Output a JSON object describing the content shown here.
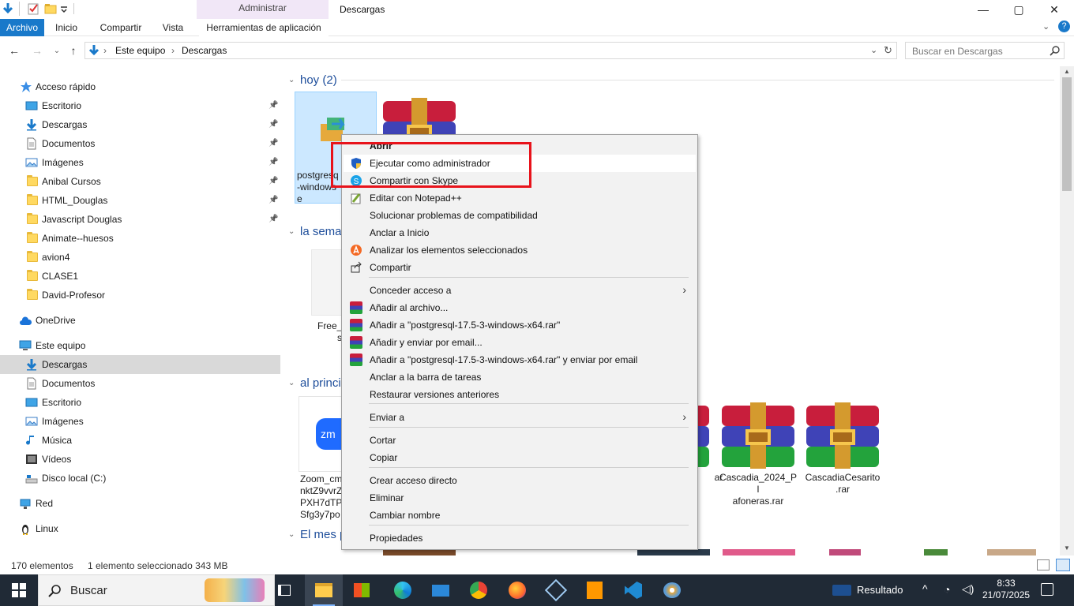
{
  "window": {
    "title": "Descargas",
    "context_tab_group": "Administrar",
    "controls": {
      "minimize": "—",
      "maximize": "▢",
      "close": "✕"
    }
  },
  "ribbon": {
    "tabs": [
      {
        "label": "Archivo"
      },
      {
        "label": "Inicio"
      },
      {
        "label": "Compartir"
      },
      {
        "label": "Vista"
      },
      {
        "label": "Herramientas de aplicación"
      }
    ]
  },
  "address": {
    "crumbs": [
      "Este equipo",
      "Descargas"
    ],
    "search_placeholder": "Buscar en Descargas"
  },
  "navpane": {
    "quick_access": "Acceso rápido",
    "items": [
      {
        "label": "Escritorio",
        "icon": "desktop-icon",
        "pinned": true
      },
      {
        "label": "Descargas",
        "icon": "download-icon",
        "pinned": true
      },
      {
        "label": "Documentos",
        "icon": "document-icon",
        "pinned": true
      },
      {
        "label": "Imágenes",
        "icon": "pictures-icon",
        "pinned": true
      },
      {
        "label": "Anibal Cursos",
        "icon": "folder-icon",
        "pinned": true
      },
      {
        "label": "HTML_Douglas",
        "icon": "folder-icon",
        "pinned": true
      },
      {
        "label": "Javascript Douglas",
        "icon": "folder-icon",
        "pinned": true
      },
      {
        "label": "Animate--huesos",
        "icon": "folder-icon",
        "pinned": false
      },
      {
        "label": "avion4",
        "icon": "folder-icon",
        "pinned": false
      },
      {
        "label": "CLASE1",
        "icon": "folder-icon",
        "pinned": false
      },
      {
        "label": "David-Profesor",
        "icon": "folder-icon",
        "pinned": false
      }
    ],
    "onedrive": "OneDrive",
    "this_pc": "Este equipo",
    "pc_items": [
      {
        "label": "Descargas",
        "icon": "download-icon",
        "selected": true
      },
      {
        "label": "Documentos",
        "icon": "document-icon",
        "selected": false
      },
      {
        "label": "Escritorio",
        "icon": "desktop-icon",
        "selected": false
      },
      {
        "label": "Imágenes",
        "icon": "pictures-icon",
        "selected": false
      },
      {
        "label": "Música",
        "icon": "music-icon",
        "selected": false
      },
      {
        "label": "Vídeos",
        "icon": "video-icon",
        "selected": false
      },
      {
        "label": "Disco local (C:)",
        "icon": "drive-icon",
        "selected": false
      }
    ],
    "network": "Red",
    "linux": "Linux"
  },
  "content": {
    "groups": [
      {
        "label": "hoy (2)"
      },
      {
        "label": "la sema"
      },
      {
        "label": "al princi"
      },
      {
        "label": "El mes p"
      }
    ],
    "files": [
      {
        "name": "postgresq\n-windows\ne",
        "selected": true
      },
      {
        "name": "",
        "selected": false
      },
      {
        "name": "Free_Toll_\ns",
        "selected": false
      },
      {
        "name": "Zoom_cm\nnktZ9vvrZ\nPXH7dTP\nSfg3y7po",
        "selected": false
      },
      {
        "name": "ar",
        "selected": false
      },
      {
        "name": "Cascadia_2024_Pl\nafoneras.rar",
        "selected": false
      },
      {
        "name": "CascadiaCesarito\n.rar",
        "selected": false
      }
    ]
  },
  "status": {
    "count": "170 elementos",
    "selection": "1 elemento seleccionado  343 MB"
  },
  "context_menu": {
    "items": [
      {
        "label": "Abrir",
        "icon": "",
        "bold": true
      },
      {
        "label": "Ejecutar como administrador",
        "icon": "uac-shield-icon",
        "hover": true
      },
      {
        "label": "Compartir con Skype",
        "icon": "skype-icon"
      },
      {
        "label": "Editar con Notepad++",
        "icon": "notepadpp-icon"
      },
      {
        "label": "Solucionar problemas de compatibilidad",
        "icon": ""
      },
      {
        "label": "Anclar a Inicio",
        "icon": ""
      },
      {
        "label": "Analizar los elementos seleccionados",
        "icon": "avast-icon"
      },
      {
        "label": "Compartir",
        "icon": "share-icon"
      },
      {
        "label": "Conceder acceso a",
        "icon": "",
        "submenu": true
      },
      {
        "label": "Añadir al archivo...",
        "icon": "winrar-icon"
      },
      {
        "label": "Añadir a \"postgresql-17.5-3-windows-x64.rar\"",
        "icon": "winrar-icon"
      },
      {
        "label": "Añadir y enviar por email...",
        "icon": "winrar-icon"
      },
      {
        "label": "Añadir a \"postgresql-17.5-3-windows-x64.rar\" y enviar por email",
        "icon": "winrar-icon"
      },
      {
        "label": "Anclar a la barra de tareas",
        "icon": ""
      },
      {
        "label": "Restaurar versiones anteriores",
        "icon": ""
      },
      {
        "label": "Enviar a",
        "icon": "",
        "submenu": true
      },
      {
        "label": "Cortar",
        "icon": ""
      },
      {
        "label": "Copiar",
        "icon": ""
      },
      {
        "label": "Crear acceso directo",
        "icon": ""
      },
      {
        "label": "Eliminar",
        "icon": ""
      },
      {
        "label": "Cambiar nombre",
        "icon": ""
      },
      {
        "label": "Propiedades",
        "icon": ""
      }
    ],
    "highlight_color": "#e8131b"
  },
  "taskbar": {
    "search_placeholder": "Buscar",
    "weather": "Resultado",
    "time": "8:33",
    "date": "21/07/2025",
    "apps": [
      "task-view-icon",
      "file-explorer-icon",
      "store-icon",
      "edge-icon",
      "mail-icon",
      "chrome-icon",
      "firefox-icon",
      "virtualbox-icon",
      "sublime-icon",
      "vscode-icon",
      "paint-icon"
    ]
  },
  "colors": {
    "accent": "#1979ca",
    "selection": "#cce8ff",
    "group_header": "#1e4e9b",
    "taskbar": "#202a36"
  }
}
